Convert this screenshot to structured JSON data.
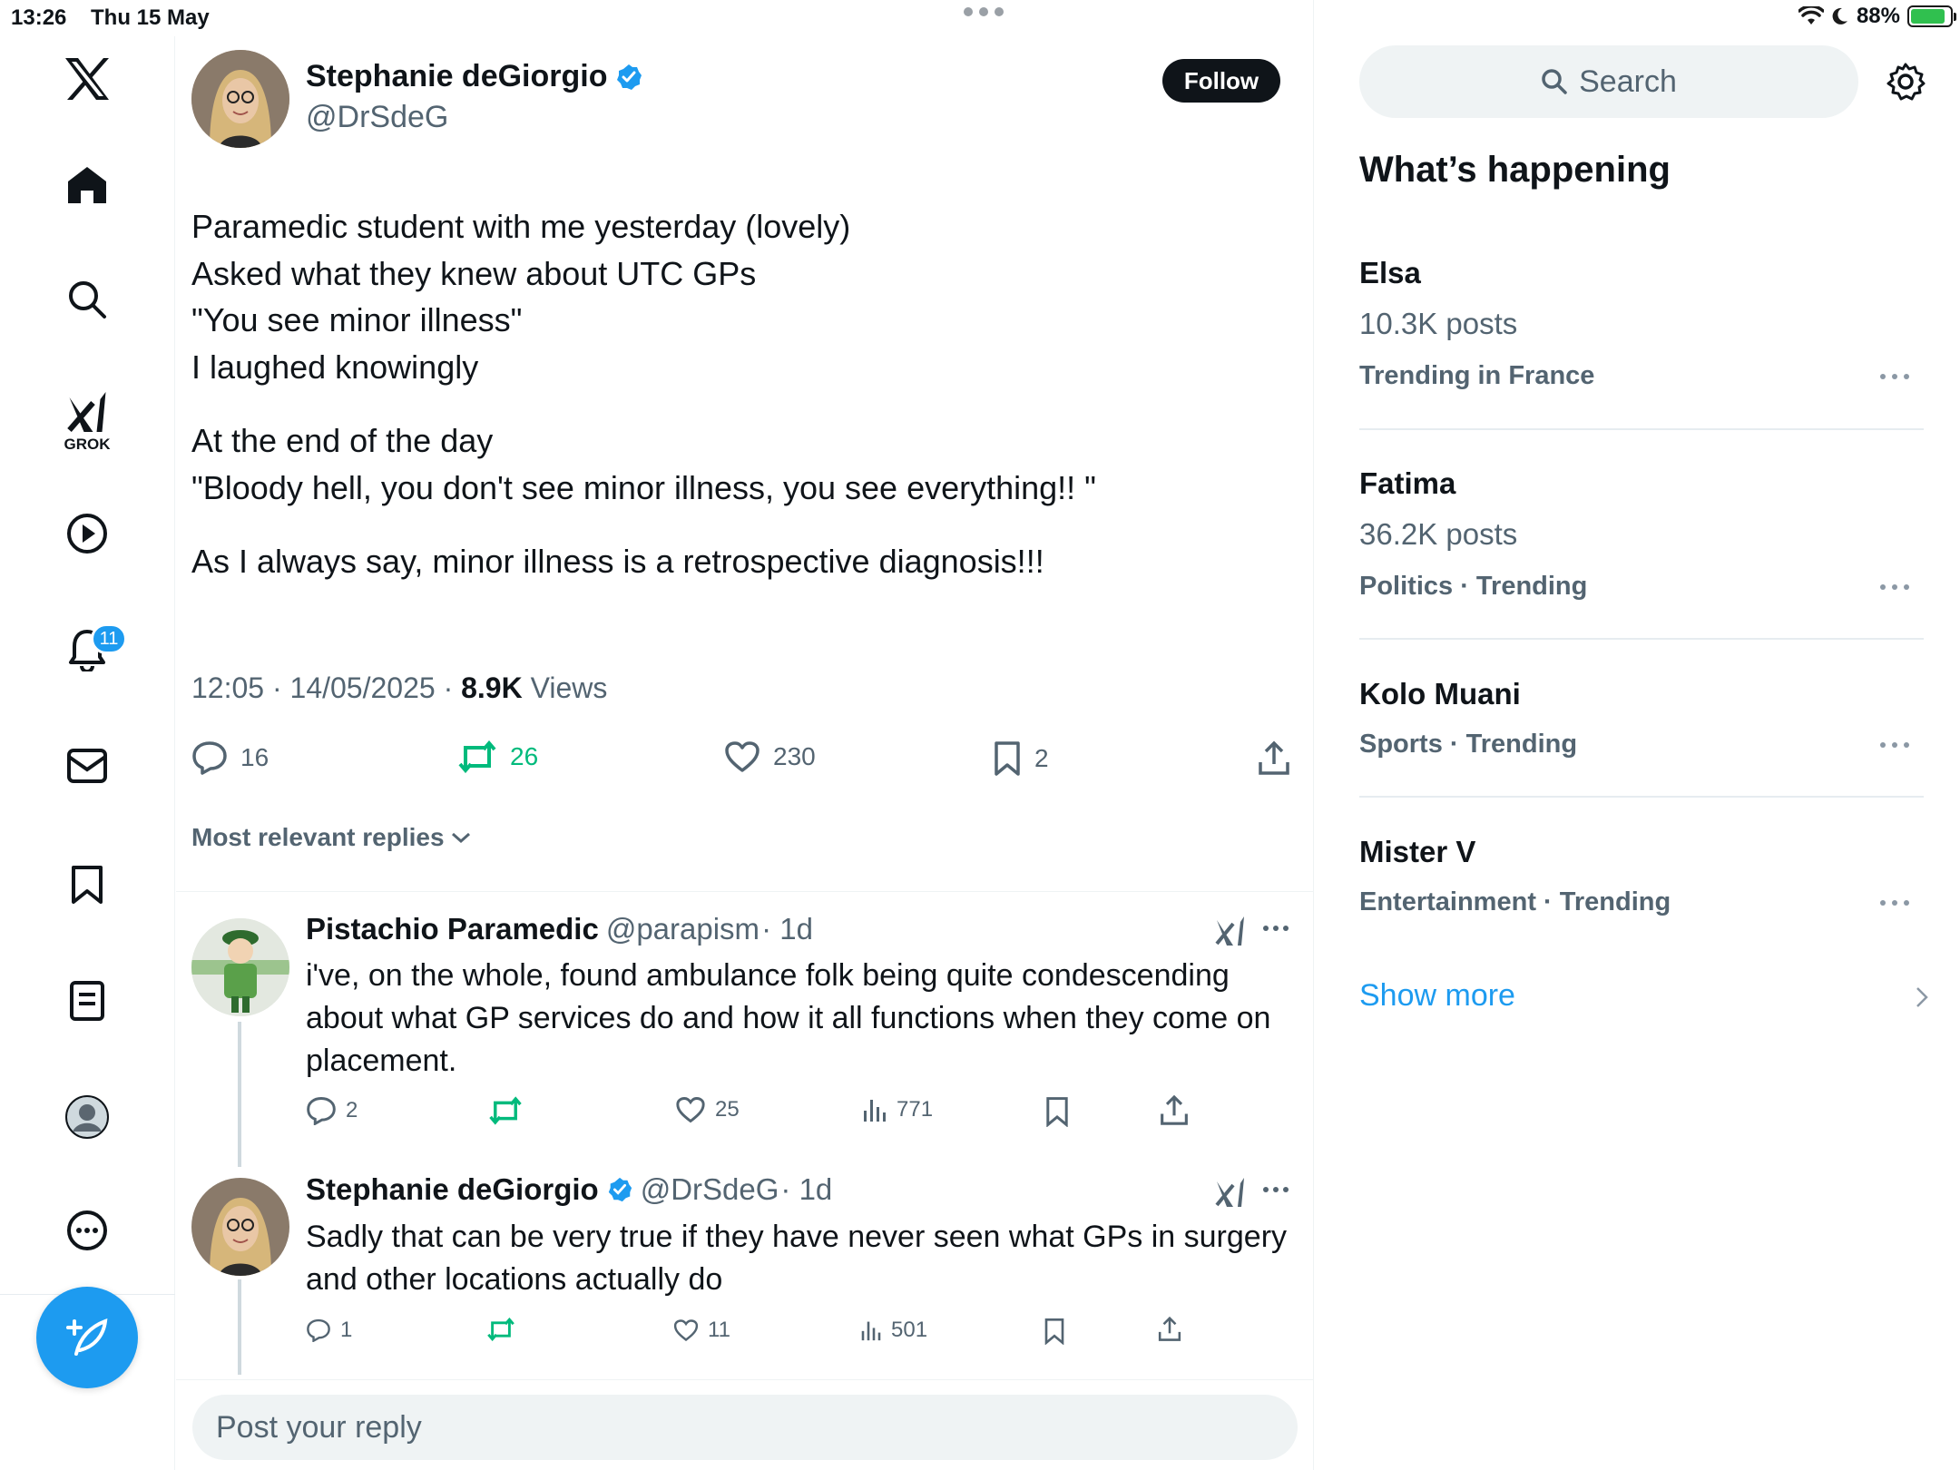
{
  "status_bar": {
    "time": "13:26",
    "date": "Thu 15 May",
    "battery": "88%"
  },
  "nav": {
    "grok_label": "GROK",
    "notifications_badge": "11",
    "items": [
      "x-logo-icon",
      "home-icon",
      "search-icon",
      "grok-icon",
      "video-icon",
      "notifications-icon",
      "messages-icon",
      "bookmarks-icon",
      "lists-icon",
      "profile-icon",
      "more-icon"
    ]
  },
  "tweet": {
    "author": {
      "name": "Stephanie deGiorgio",
      "handle": "@DrSdeG",
      "verified": true
    },
    "follow_label": "Follow",
    "lines": [
      "Paramedic student with me yesterday (lovely)",
      "Asked what they knew about UTC GPs",
      "\"You see minor illness\"",
      "I laughed knowingly",
      "",
      "At the end of the day",
      "\"Bloody hell, you don't see minor illness, you see everything!! \"",
      "",
      "As I always say, minor illness is a retrospective diagnosis!!!"
    ],
    "time": "12:05 · 14/05/2025 · ",
    "views": "8.9K",
    "views_label": " Views",
    "stats": {
      "replies": "16",
      "reposts": "26",
      "likes": "230",
      "bookmarks": "2"
    }
  },
  "replies_sort": "Most relevant replies",
  "replies": [
    {
      "name": "Pistachio Paramedic",
      "handle": "@parapism",
      "age": "· 1d",
      "lines": [
        "i've, on the whole,  found ambulance folk being quite condescending",
        "about what GP services do and how it all functions when they come on",
        "placement."
      ],
      "stats": {
        "replies": "2",
        "reposts": "",
        "likes": "25",
        "views": "771"
      }
    },
    {
      "name": "Stephanie deGiorgio",
      "handle": "@DrSdeG",
      "age": "· 1d",
      "lines": [
        "Sadly that can be very true if they have never seen what GPs in surgery",
        "and other locations actually do"
      ],
      "stats": {
        "replies": "1",
        "reposts": "",
        "likes": "11",
        "views": "501"
      }
    }
  ],
  "reply_placeholder": "Post your reply",
  "sidebar": {
    "search_placeholder": "Search",
    "heading": "What’s happening",
    "trends": [
      {
        "title": "Elsa",
        "posts": "10.3K posts",
        "context": "Trending in France"
      },
      {
        "title": "Fatima",
        "posts": "36.2K posts",
        "context": "Politics · Trending"
      },
      {
        "title": "Kolo Muani",
        "posts": "",
        "context": "Sports · Trending"
      },
      {
        "title": "Mister V",
        "posts": "",
        "context": "Entertainment · Trending"
      }
    ],
    "show_more": "Show more"
  },
  "colors": {
    "accent": "#1d9bf0",
    "repost_green": "#00ba7c",
    "text": "#0f1419",
    "muted": "#536471"
  }
}
